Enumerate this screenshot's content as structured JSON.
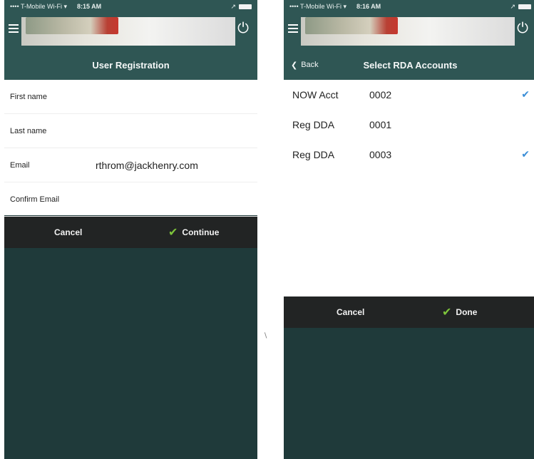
{
  "left_screen": {
    "status": {
      "carrier": "•••• T-Mobile Wi-Fi ▾",
      "time": "8:15 AM"
    },
    "header": {
      "power_label": ""
    },
    "title": "User Registration",
    "fields": [
      {
        "label": "First name",
        "value": ""
      },
      {
        "label": "Last name",
        "value": ""
      },
      {
        "label": "Email",
        "value": "rthrom@jackhenry.com"
      },
      {
        "label": "Confirm Email",
        "value": ""
      }
    ],
    "actions": {
      "cancel": "Cancel",
      "continue": "Continue"
    }
  },
  "right_screen": {
    "status": {
      "carrier": "•••• T-Mobile Wi-Fi ▾",
      "time": "8:16 AM"
    },
    "back": "Back",
    "title": "Select RDA Accounts",
    "accounts": [
      {
        "type": "NOW Acct",
        "number": "0002",
        "selected": true
      },
      {
        "type": "Reg DDA",
        "number": "0001",
        "selected": false
      },
      {
        "type": "Reg DDA",
        "number": "0003",
        "selected": true
      }
    ],
    "actions": {
      "cancel": "Cancel",
      "done": "Done"
    }
  },
  "colors": {
    "teal_bar": "#2f5654",
    "dark_panel": "#1f3a3a",
    "action_bar": "#222424",
    "check_green": "#7ec53b",
    "check_blue": "#3b8ed7"
  },
  "icons": [
    "hamburger-icon",
    "power-icon",
    "check-icon",
    "chevron-left-icon",
    "battery-icon",
    "wifi-icon"
  ]
}
